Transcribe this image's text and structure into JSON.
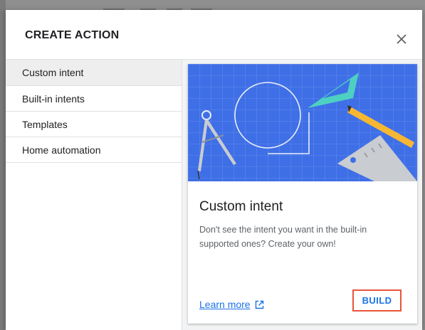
{
  "dialog": {
    "title": "CREATE ACTION",
    "close_icon": "close-icon"
  },
  "sidebar": {
    "items": [
      {
        "label": "Custom intent",
        "active": true
      },
      {
        "label": "Built-in intents",
        "active": false
      },
      {
        "label": "Templates",
        "active": false
      },
      {
        "label": "Home automation",
        "active": false
      }
    ]
  },
  "card": {
    "hero_icon": "drafting-tools-illustration",
    "title": "Custom intent",
    "description": "Don't see the intent you want in the built-in supported ones? Create your own!",
    "learn_more_label": "Learn more",
    "learn_more_icon": "open-in-new-icon",
    "build_label": "BUILD"
  },
  "colors": {
    "hero_bg": "#3f6fe6",
    "link": "#1a73e8",
    "highlight": "#e8543a",
    "active_item_bg": "#eeeeee"
  }
}
